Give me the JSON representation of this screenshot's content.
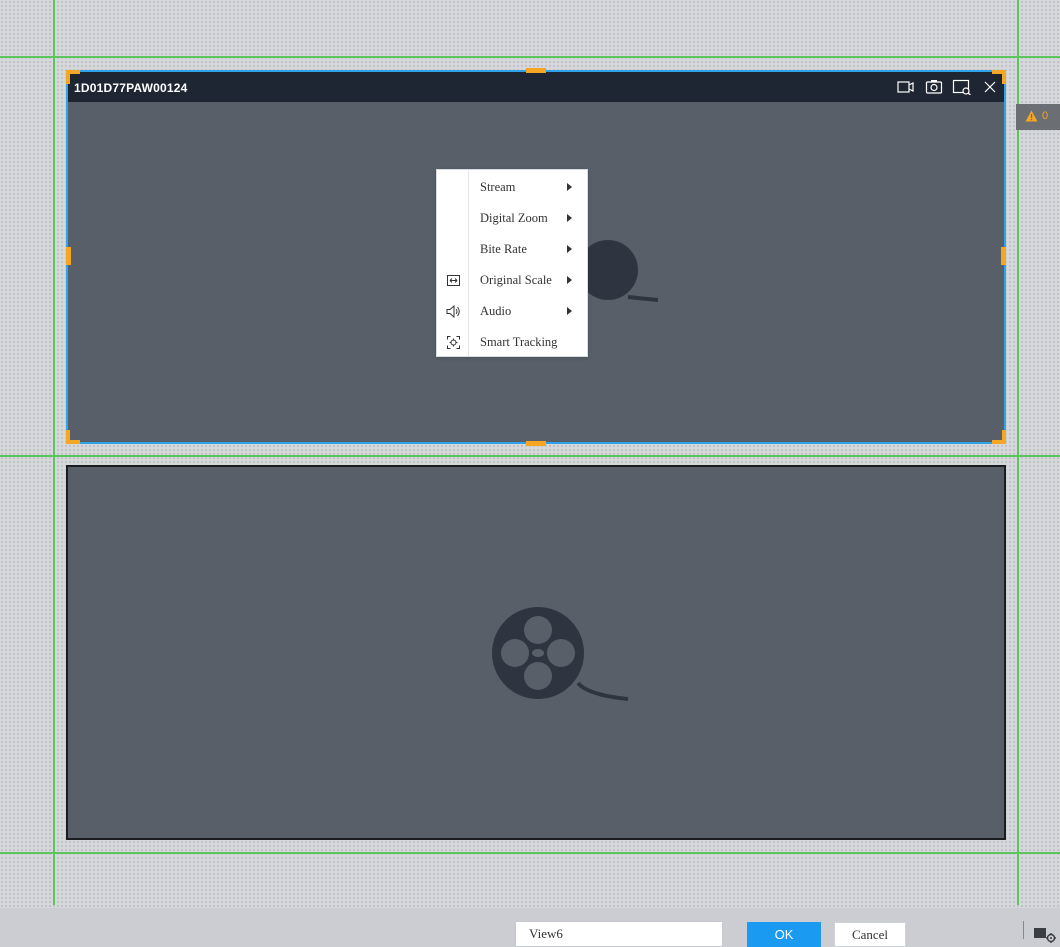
{
  "window1": {
    "title": "1D01D77PAW00124",
    "toolbar_icons": [
      "record-icon",
      "snapshot-icon",
      "instant-playback-icon",
      "close-icon"
    ],
    "empty_icon": "film-reel-icon"
  },
  "window2": {
    "empty_icon": "film-reel-icon"
  },
  "context_menu": {
    "items": [
      {
        "label": "Stream",
        "icon": "",
        "submenu": true
      },
      {
        "label": "Digital Zoom",
        "icon": "",
        "submenu": true
      },
      {
        "label": "Bite Rate",
        "icon": "",
        "submenu": true
      },
      {
        "label": "Original Scale",
        "icon": "fit-scale-icon",
        "submenu": true
      },
      {
        "label": "Audio",
        "icon": "speaker-icon",
        "submenu": true
      },
      {
        "label": "Smart Tracking",
        "icon": "smart-tracking-icon",
        "submenu": false
      }
    ]
  },
  "alarm": {
    "icon": "warning-icon",
    "count": "0"
  },
  "bottombar": {
    "view_name": "View6",
    "ok_label": "OK",
    "cancel_label": "Cancel",
    "settings_icon": "window-settings-icon"
  },
  "colors": {
    "selection_border": "#2fa3e7",
    "resize_handle": "#f5a623",
    "grid_line": "#5cc55c",
    "primary_button": "#1b9af2",
    "video_background": "#585f69"
  }
}
